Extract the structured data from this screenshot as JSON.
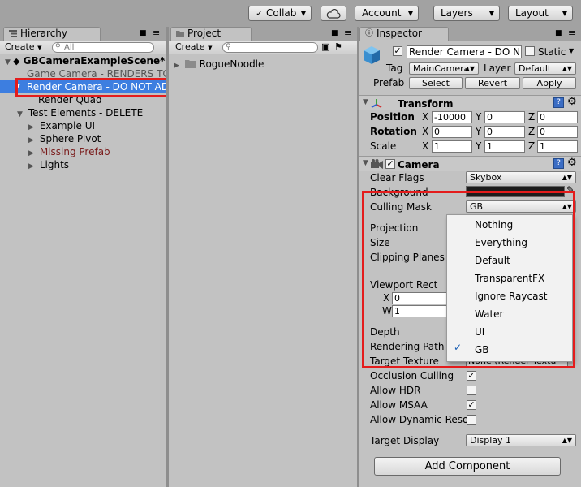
{
  "toolbar": {
    "collab": "Collab",
    "account": "Account",
    "layers": "Layers",
    "layout": "Layout"
  },
  "hierarchy": {
    "tab": "Hierarchy",
    "create": "Create",
    "search_placeholder": "All",
    "items": [
      {
        "label": "GBCameraExampleScene*"
      },
      {
        "label": "Game Camera - RENDERS TO"
      },
      {
        "label": "Render Camera - DO NOT ADD"
      },
      {
        "label": "Render Quad"
      },
      {
        "label": "Test Elements - DELETE"
      },
      {
        "label": "Example UI"
      },
      {
        "label": "Sphere Pivot"
      },
      {
        "label": "Missing Prefab"
      },
      {
        "label": "Lights"
      }
    ]
  },
  "project": {
    "tab": "Project",
    "create": "Create",
    "items": [
      {
        "label": "RogueNoodle"
      }
    ]
  },
  "inspector": {
    "tab": "Inspector",
    "object_name": "Render Camera - DO N",
    "static_label": "Static",
    "tag_label": "Tag",
    "tag_value": "MainCamera",
    "layer_label": "Layer",
    "layer_value": "Default",
    "prefab_label": "Prefab",
    "prefab_select": "Select",
    "prefab_revert": "Revert",
    "prefab_apply": "Apply",
    "transform": {
      "title": "Transform",
      "position_label": "Position",
      "rotation_label": "Rotation",
      "scale_label": "Scale",
      "x": "X",
      "y": "Y",
      "z": "Z",
      "position": [
        "-10000",
        "0",
        "0"
      ],
      "rotation": [
        "0",
        "0",
        "0"
      ],
      "scale": [
        "1",
        "1",
        "1"
      ]
    },
    "camera": {
      "title": "Camera",
      "clear_flags_label": "Clear Flags",
      "clear_flags_value": "Skybox",
      "background_label": "Background",
      "culling_mask_label": "Culling Mask",
      "culling_mask_value": "GB",
      "projection_label": "Projection",
      "size_label": "Size",
      "clipping_planes_label": "Clipping Planes",
      "viewport_rect_label": "Viewport Rect",
      "viewport_x_label": "X",
      "viewport_x_value": "0",
      "viewport_w_label": "W",
      "viewport_w_value": "1",
      "depth_label": "Depth",
      "rendering_path_label": "Rendering Path",
      "target_texture_label": "Target Texture",
      "target_texture_value": "None (Render Textu",
      "occlusion_culling_label": "Occlusion Culling",
      "allow_hdr_label": "Allow HDR",
      "allow_msaa_label": "Allow MSAA",
      "allow_dynamic_label": "Allow Dynamic Reso",
      "target_display_label": "Target Display",
      "target_display_value": "Display 1"
    },
    "add_component": "Add Component"
  },
  "culling_menu": {
    "items": [
      "Nothing",
      "Everything",
      "Default",
      "TransparentFX",
      "Ignore Raycast",
      "Water",
      "UI",
      "GB"
    ],
    "checked": "GB"
  },
  "colors": {
    "highlight_red": "#e41c1c",
    "selection_blue": "#3d7ee0"
  }
}
